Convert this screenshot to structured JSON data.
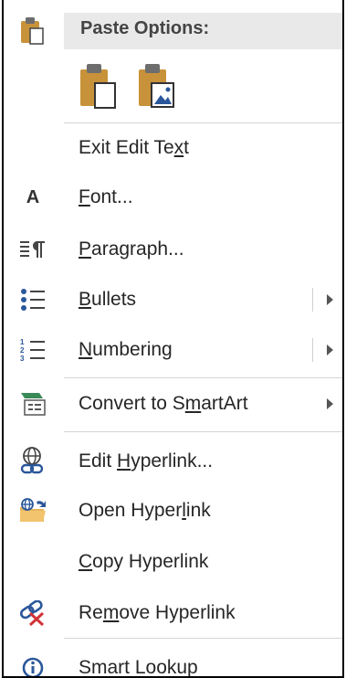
{
  "menu": {
    "paste_header": "Paste Options:",
    "paste_buttons": [
      {
        "icon": "paste-keep-text-icon"
      },
      {
        "icon": "paste-picture-icon"
      }
    ],
    "items": [
      {
        "pre": "Exit Edit Te",
        "key": "x",
        "post": "t",
        "icon": ""
      },
      {
        "pre": "",
        "key": "F",
        "post": "ont...",
        "icon": "font-icon",
        "icon_text": "A"
      },
      {
        "pre": "",
        "key": "P",
        "post": "aragraph...",
        "icon": "paragraph-icon"
      },
      {
        "pre": "",
        "key": "B",
        "post": "ullets",
        "icon": "bullets-icon",
        "submenu": true
      },
      {
        "pre": "",
        "key": "N",
        "post": "umbering",
        "icon": "numbering-icon",
        "submenu": true
      },
      {
        "pre": "Convert to S",
        "key": "m",
        "post": "artArt",
        "icon": "smartart-icon",
        "submenu": true
      },
      {
        "pre": "Edit ",
        "key": "H",
        "post": "yperlink...",
        "icon": "edit-hyperlink-icon"
      },
      {
        "pre": "Open Hyper",
        "key": "l",
        "post": "ink",
        "icon": "open-hyperlink-icon"
      },
      {
        "pre": "",
        "key": "C",
        "post": "opy Hyperlink",
        "icon": ""
      },
      {
        "pre": "Re",
        "key": "m",
        "post": "ove Hyperlink",
        "icon": "remove-hyperlink-icon"
      },
      {
        "pre": "Smart Lookup",
        "key": "",
        "post": "",
        "icon": "smart-lookup-icon"
      }
    ]
  },
  "colors": {
    "accent_blue": "#2b579a",
    "clipboard_tan": "#c8923a",
    "remove_red": "#d13438",
    "header_band": "#e9e9e9"
  }
}
